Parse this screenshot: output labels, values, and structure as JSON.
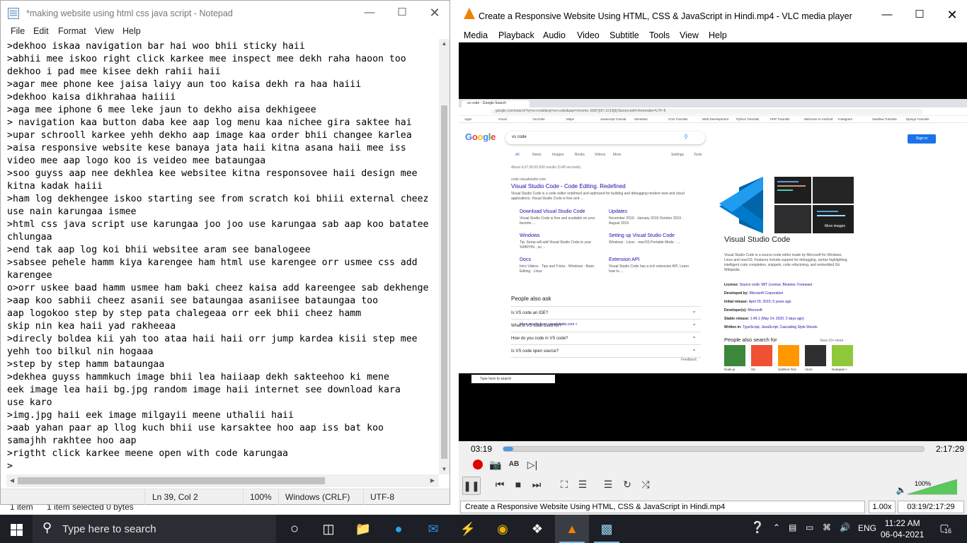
{
  "explorer": {
    "status_items": "1 item",
    "status_selected": "1 item selected  0 bytes"
  },
  "notepad": {
    "title": "*making website using html css java script - Notepad",
    "menu": [
      "File",
      "Edit",
      "Format",
      "View",
      "Help"
    ],
    "lines": [
      ">dekhoo iskaa navigation bar hai woo bhii sticky haii",
      ">abhii mee iskoo right click karkee mee inspect mee dekh raha haoon too",
      "dekhoo i pad mee kisee dekh rahii haii",
      ">agar mee phone kee jaisa laiyy aun too kaisa dekh ra haa haiii",
      ">dekhoo kaisa dikhrahaa haiiii",
      ">aga mee iphone 6 mee leke jaun to dekho aisa dekhigeee",
      "> navigation kaa button daba kee aap log menu kaa nichee gira saktee hai",
      ">upar schrooll karkee yehh dekho aap image kaa order bhii changee karlea",
      ">aisa responsive website kese banaya jata haii kitna asana haii mee iss",
      "video mee aap logo koo is veideo mee bataungaa",
      ">soo guyss aap nee dekhlea kee websitee kitna responsovee haii design mee",
      "kitna kadak haiii",
      ">ham log dekhengee iskoo starting see from scratch koi bhiii external cheez",
      "use nain karungaa ismee",
      ">html css java script use karungaa joo joo use karungaa sab aap koo batatee",
      "chlungaa",
      ">end tak aap log koi bhii websitee aram see banalogeee",
      ">sabsee pehele hamm kiya karengee ham html use karengee orr usmee css add",
      "karengee",
      "o>orr uskee baad hamm usmee ham baki cheez kaisa add kareengee sab dekhenge",
      ">aap koo sabhii cheez asanii see bataungaa asaniisee bataungaa too",
      "aap logokoo step by step pata chalegeaa orr eek bhii cheez hamm",
      "skip nin kea haii yad rakheeaa",
      ">direcly boldea kii yah too ataa haii haii orr jump kardea kisii step mee",
      "yehh too bilkul nin hogaaa",
      ">step by step hamm bataungaa",
      ">dekhea guyss hammkuch image bhii lea haiiaap dekh sakteehoo ki mene",
      "eek image lea haii bg.jpg random image haii internet see download kara",
      "use karo",
      ">img.jpg haii eek image milgayii meene uthalii haii",
      ">aab yahan paar ap llog kuch bhii use karsaktee hoo aap iss bat koo",
      "samajhh rakhtee hoo aap",
      ">rigtht click karkee meene open with code karungaa",
      ">"
    ],
    "status": {
      "position": "Ln 39, Col 2",
      "zoom": "100%",
      "line_ending": "Windows (CRLF)",
      "encoding": "UTF-8"
    }
  },
  "vlc": {
    "title": "Create a Responsive Website Using HTML, CSS & JavaScript in Hindi.mp4 - VLC media player",
    "menu": [
      "Media",
      "Playback",
      "Audio",
      "Video",
      "Subtitle",
      "Tools",
      "View",
      "Help"
    ],
    "time_current": "03:19",
    "time_total": "2:17:29",
    "progress_fraction": 0.024,
    "volume": "100%",
    "volume_fraction": 1.0,
    "status_file": "Create a Responsive Website Using HTML, CSS & JavaScript in Hindi.mp4",
    "speed": "1.00x",
    "status_time": "03:19/2:17:29",
    "video": {
      "tab_title": "vs code - Google Search",
      "url": "google.com/search?q=vs+code&oq=vs+code&aqs=chrome..69i57j0l7.1613j0j7&sourceid=chrome&ie=UTF-8",
      "bookmarks": [
        "Apps",
        "Gmail",
        "YouTube",
        "Maps",
        "Javascript Tutorial",
        "Simulator",
        "Cms Tutorials",
        "Web Development",
        "Python Tutorials",
        "PHP Tutorials",
        "Welcome to Android",
        "Instagram",
        "Swallow Tutorials",
        "Django Tutorials"
      ],
      "logo": "Google",
      "query": "vs code",
      "signin": "Sign in",
      "tabs": [
        "All",
        "News",
        "Images",
        "Books",
        "Videos",
        "More",
        "Settings",
        "Tools"
      ],
      "results_count": "About 4,07,00,00,000 results (0.48 seconds)",
      "site": "code.visualstudio.com",
      "main_link": "Visual Studio Code - Code Editing. Redefined",
      "main_desc": "Visual Studio Code is a code editor redefined and optimized for building and debugging modern web and cloud applications. Visual Studio Code is free and ...",
      "sitelinks": [
        {
          "title": "Download Visual Studio Code",
          "desc": "Visual Studio Code is free and available on your favorite ..."
        },
        {
          "title": "Updates",
          "desc": "November 2019 · January 2019 October 2019 · August 2019"
        },
        {
          "title": "Windows",
          "desc": "Tip: Setup will add Visual Studio Code to your %PATH% , so ..."
        },
        {
          "title": "Setting up Visual Studio Code",
          "desc": "Windows · Linux · macOS Portable Mode · ..."
        },
        {
          "title": "Docs",
          "desc": "Intro Videos · Tips and Tricks · Windows · Basic Editing · Linux"
        },
        {
          "title": "Extension API",
          "desc": "Visual Studio Code has a rich extension API. Learn how to ..."
        }
      ],
      "more_results": "More results from visualstudio.com »",
      "paa_heading": "People also ask",
      "paa": [
        "Is VS code an IDE?",
        "What is VS code used for?",
        "How do you code in VS code?",
        "Is VS code open source?"
      ],
      "feedback": "Feedback",
      "more_images": "More images",
      "kp_title": "Visual Studio Code",
      "kp_desc": "Visual Studio Code is a source-code editor made by Microsoft for Windows, Linux and macOS. Features include support for debugging, syntax highlighting, intelligent code completion, snippets, code refactoring, and embedded Git. Wikipedia",
      "kp_facts": [
        {
          "label": "License:",
          "value": "Source code: MIT License; Binaries: Freeware"
        },
        {
          "label": "Developed by:",
          "value": "Microsoft Corporation"
        },
        {
          "label": "Initial release:",
          "value": "April 29, 2015; 5 years ago"
        },
        {
          "label": "Developer(s):",
          "value": "Microsoft"
        },
        {
          "label": "Stable release:",
          "value": "1.49.1 (May 14, 2020; 2 days ago)"
        },
        {
          "label": "Written in:",
          "value": "TypeScript, JavaScript, Cascading Style Sheets"
        }
      ],
      "kp_also": "People also search for",
      "kp_view_more": "View 10+ more",
      "kp_apps": [
        "Node.js",
        "Git",
        "Sublime Text",
        "Atom",
        "Notepad++"
      ],
      "colors": {
        "node": "#3c873a",
        "git": "#f05033",
        "sublime": "#ff9800",
        "atom": "#2f2f2f",
        "npp": "#90c83c"
      },
      "taskbar_search": "Type here to search"
    }
  },
  "taskbar": {
    "search_placeholder": "Type here to search",
    "lang": "ENG",
    "time": "11:22 AM",
    "date": "06-04-2021",
    "notif_count": "16"
  },
  "colors": {
    "vlc_orange": "#f08000",
    "seek_fill": "#4a9ae0",
    "taskbar_bg": "#1c1f26",
    "google_link": "#1a0dab"
  }
}
